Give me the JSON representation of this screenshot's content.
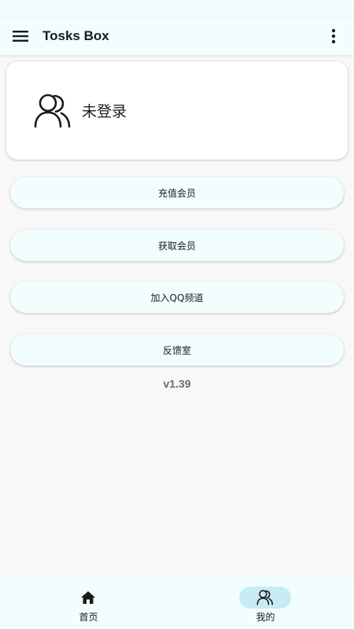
{
  "app_bar": {
    "title": "Tosks Box",
    "menu_icon": "hamburger-menu-icon",
    "more_icon": "more-vert-icon"
  },
  "profile": {
    "status": "未登录",
    "avatar_icon": "people-outline-icon"
  },
  "actions": [
    {
      "label": "充值会员"
    },
    {
      "label": "获取会员"
    },
    {
      "label": "加入QQ频道"
    },
    {
      "label": "反馈室"
    }
  ],
  "version": "v1.39",
  "bottom_nav": {
    "items": [
      {
        "label": "首页",
        "icon": "home-icon",
        "selected": false
      },
      {
        "label": "我的",
        "icon": "people-outline-icon",
        "selected": true
      }
    ]
  },
  "colors": {
    "bar_bg": "#f2fdfd",
    "page_bg": "#f8f8f8",
    "selected_indicator": "#c8ecf5"
  }
}
